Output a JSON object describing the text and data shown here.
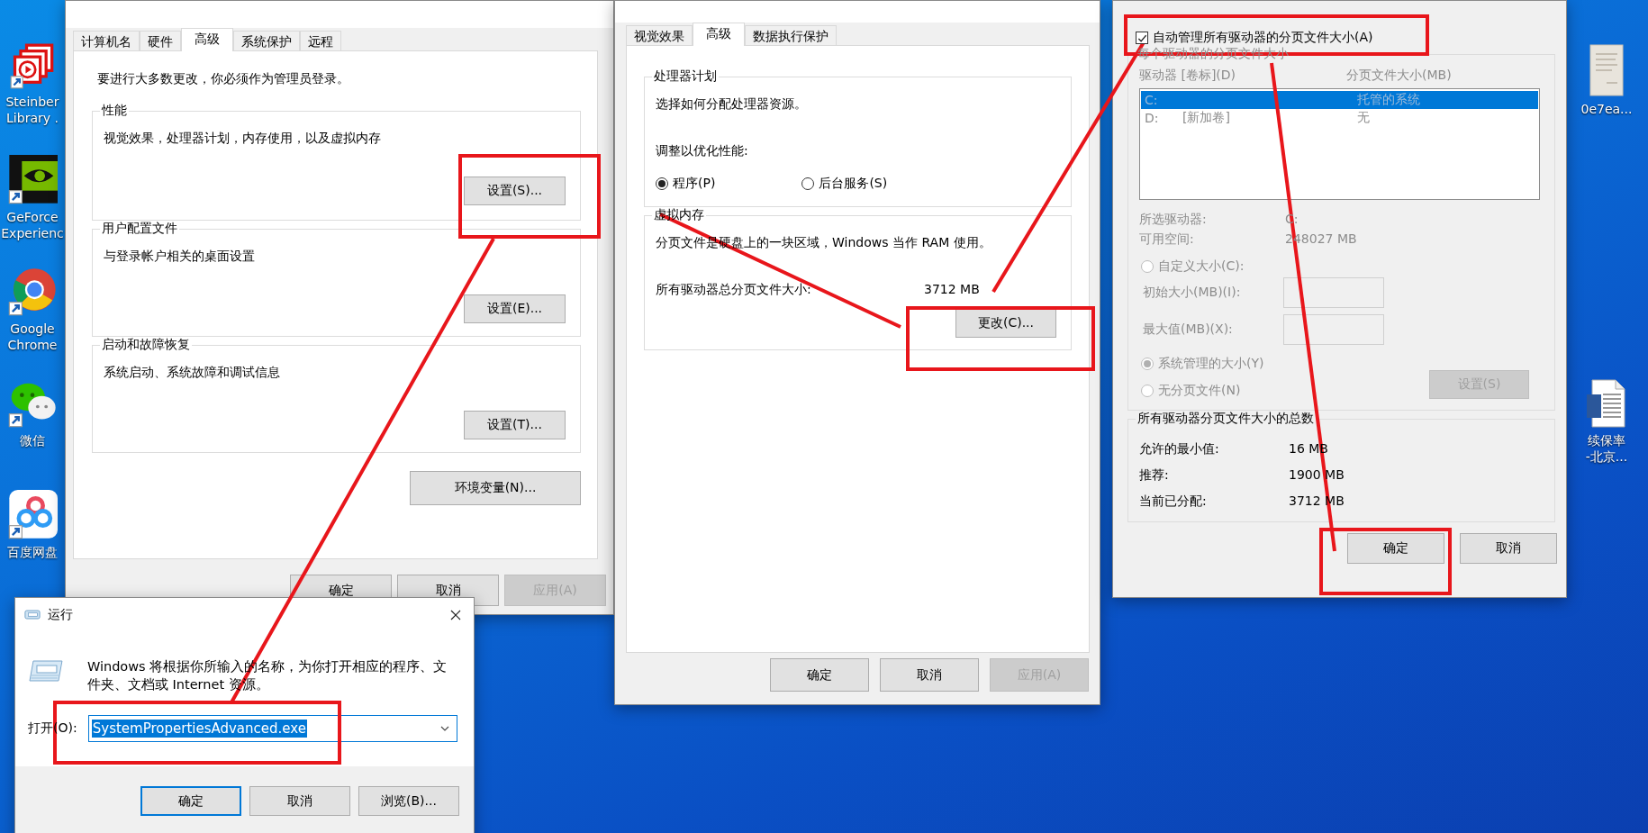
{
  "desktop": {
    "left_icons": [
      {
        "kind": "media-stack",
        "label_lines": [
          "Steinber",
          "Library ."
        ]
      },
      {
        "kind": "eye-logo",
        "label_lines": [
          "GeForce",
          "Experienc"
        ]
      },
      {
        "kind": "browser",
        "label_lines": [
          "Google",
          "Chrome"
        ]
      },
      {
        "kind": "chat",
        "label_lines": [
          "微信"
        ]
      },
      {
        "kind": "cloud-rings",
        "label_lines": [
          "百度网盘"
        ]
      }
    ],
    "right_icons": [
      {
        "kind": "paper",
        "label_lines": [
          "0e7ea..."
        ]
      },
      {
        "kind": "word",
        "label_lines": [
          "续保率",
          "-北京..."
        ]
      }
    ]
  },
  "system_properties": {
    "tabs": [
      {
        "label": "计算机名",
        "selected": false
      },
      {
        "label": "硬件",
        "selected": false
      },
      {
        "label": "高级",
        "selected": true
      },
      {
        "label": "系统保护",
        "selected": false
      },
      {
        "label": "远程",
        "selected": false
      }
    ],
    "admin_note": "要进行大多数更改，你必须作为管理员登录。",
    "groups": [
      {
        "title": "性能",
        "description": "视觉效果，处理器计划，内存使用，以及虚拟内存",
        "button": "设置(S)..."
      },
      {
        "title": "用户配置文件",
        "description": "与登录帐户相关的桌面设置",
        "button": "设置(E)..."
      },
      {
        "title": "启动和故障恢复",
        "description": "系统启动、系统故障和调试信息",
        "button": "设置(T)..."
      }
    ],
    "env_button": "环境变量(N)...",
    "buttons": [
      {
        "label": "确定",
        "disabled": false
      },
      {
        "label": "取消",
        "disabled": false
      },
      {
        "label": "应用(A)",
        "disabled": true
      }
    ]
  },
  "performance_options": {
    "tabs": [
      {
        "label": "视觉效果",
        "selected": false
      },
      {
        "label": "高级",
        "selected": true
      },
      {
        "label": "数据执行保护",
        "selected": false
      }
    ],
    "processor": {
      "title": "处理器计划",
      "description": "选择如何分配处理器资源。",
      "adjust_label": "调整以优化性能:",
      "options": [
        {
          "label": "程序(P)",
          "selected": true
        },
        {
          "label": "后台服务(S)",
          "selected": false
        }
      ]
    },
    "virtual_memory": {
      "title": "虚拟内存",
      "description": "分页文件是硬盘上的一块区域，Windows 当作 RAM 使用。",
      "total_label": "所有驱动器总分页文件大小:",
      "total_value": "3712 MB",
      "button": "更改(C)..."
    },
    "buttons": [
      {
        "label": "确定",
        "disabled": false
      },
      {
        "label": "取消",
        "disabled": false
      },
      {
        "label": "应用(A)",
        "disabled": true
      }
    ]
  },
  "virtual_memory": {
    "auto_manage": {
      "label": "自动管理所有驱动器的分页文件大小(A)",
      "checked": true
    },
    "per_drive": {
      "title": "每个驱动器的分页文件大小",
      "disabled": true,
      "columns": [
        "驱动器 [卷标](D)",
        "分页文件大小(MB)"
      ],
      "drives": [
        {
          "drive": "C:",
          "size": "托管的系统",
          "selected": true
        },
        {
          "drive": "D:",
          "volume": "[新加卷]",
          "size": "无",
          "selected": false
        }
      ],
      "info": [
        {
          "label": "所选驱动器:",
          "value": "C:"
        },
        {
          "label": "可用空间:",
          "value": "248027 MB"
        }
      ],
      "custom": {
        "label": "自定义大小(C):",
        "selected": false
      },
      "fields": [
        {
          "label": "初始大小(MB)(I):"
        },
        {
          "label": "最大值(MB)(X):"
        }
      ],
      "options": [
        {
          "label": "系统管理的大小(Y)",
          "selected": true
        },
        {
          "label": "无分页文件(N)",
          "selected": false
        }
      ],
      "set_button": {
        "label": "设置(S)",
        "disabled": true
      }
    },
    "totals": {
      "title": "所有驱动器分页文件大小的总数",
      "rows": [
        {
          "label": "允许的最小值:",
          "value": "16 MB"
        },
        {
          "label": "推荐:",
          "value": "1900 MB"
        },
        {
          "label": "当前已分配:",
          "value": "3712 MB"
        }
      ]
    },
    "buttons": [
      {
        "label": "确定",
        "disabled": false
      },
      {
        "label": "取消",
        "disabled": false
      }
    ]
  },
  "run_dialog": {
    "title": "运行",
    "description": "Windows 将根据你所输入的名称，为你打开相应的程序、文件夹、文档或 Internet 资源。",
    "open_label": "打开(O):",
    "value": "SystemPropertiesAdvanced.exe",
    "buttons": [
      {
        "label": "确定",
        "default": true
      },
      {
        "label": "取消",
        "default": false
      },
      {
        "label": "浏览(B)...",
        "default": false
      }
    ]
  }
}
